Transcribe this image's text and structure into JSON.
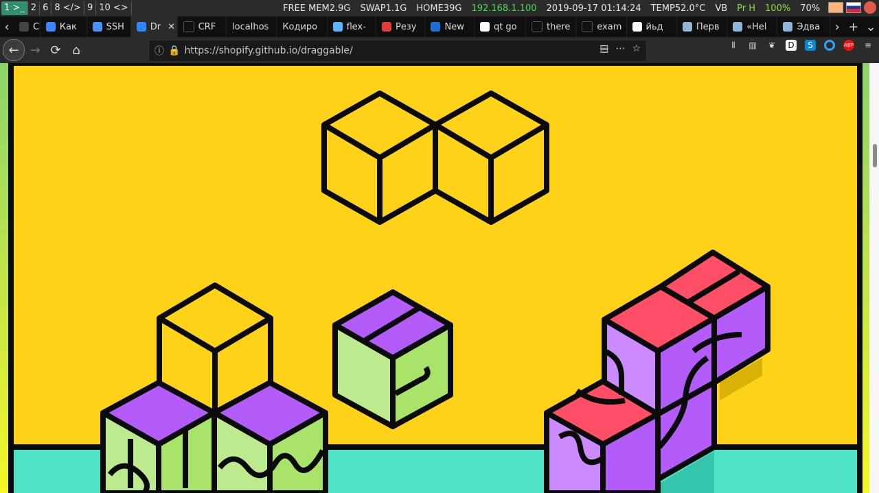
{
  "statusbar": {
    "workspaces": [
      "1 >_",
      "2",
      "6",
      "8 </>",
      "9",
      "10 <>"
    ],
    "stats": {
      "free_mem": "FREE MEM2.9G",
      "swap": "SWAP1.1G",
      "home": "HOME39G",
      "ip": "192.168.1.100",
      "datetime": "2019-09-17 01:14:24",
      "temp": "TEMP52.0°C",
      "vb": "VB",
      "prh": "Pr H",
      "battery": "100%",
      "volume": "70%"
    }
  },
  "tabs": [
    {
      "label": "Cry",
      "active": false
    },
    {
      "label": "Как",
      "active": false
    },
    {
      "label": "SSH",
      "active": false
    },
    {
      "label": "Dr",
      "active": true
    },
    {
      "label": "CRF",
      "active": false
    },
    {
      "label": "localhos",
      "active": false
    },
    {
      "label": "Кодиро",
      "active": false
    },
    {
      "label": "flex-",
      "active": false
    },
    {
      "label": "Резу",
      "active": false
    },
    {
      "label": "New",
      "active": false
    },
    {
      "label": "qt go",
      "active": false
    },
    {
      "label": "there",
      "active": false
    },
    {
      "label": "exam",
      "active": false
    },
    {
      "label": "йьд",
      "active": false
    },
    {
      "label": "Перв",
      "active": false
    },
    {
      "label": "«Hel",
      "active": false
    },
    {
      "label": "Эдва",
      "active": false
    }
  ],
  "navbar": {
    "url": "https://shopify.github.io/draggable/"
  },
  "colors": {
    "yellow": "#ffd21a",
    "teal": "#4ee3c5",
    "purple": "#b35cf9",
    "green": "#bde98f",
    "red": "#ff4f66",
    "ink": "#0b0b0b"
  }
}
